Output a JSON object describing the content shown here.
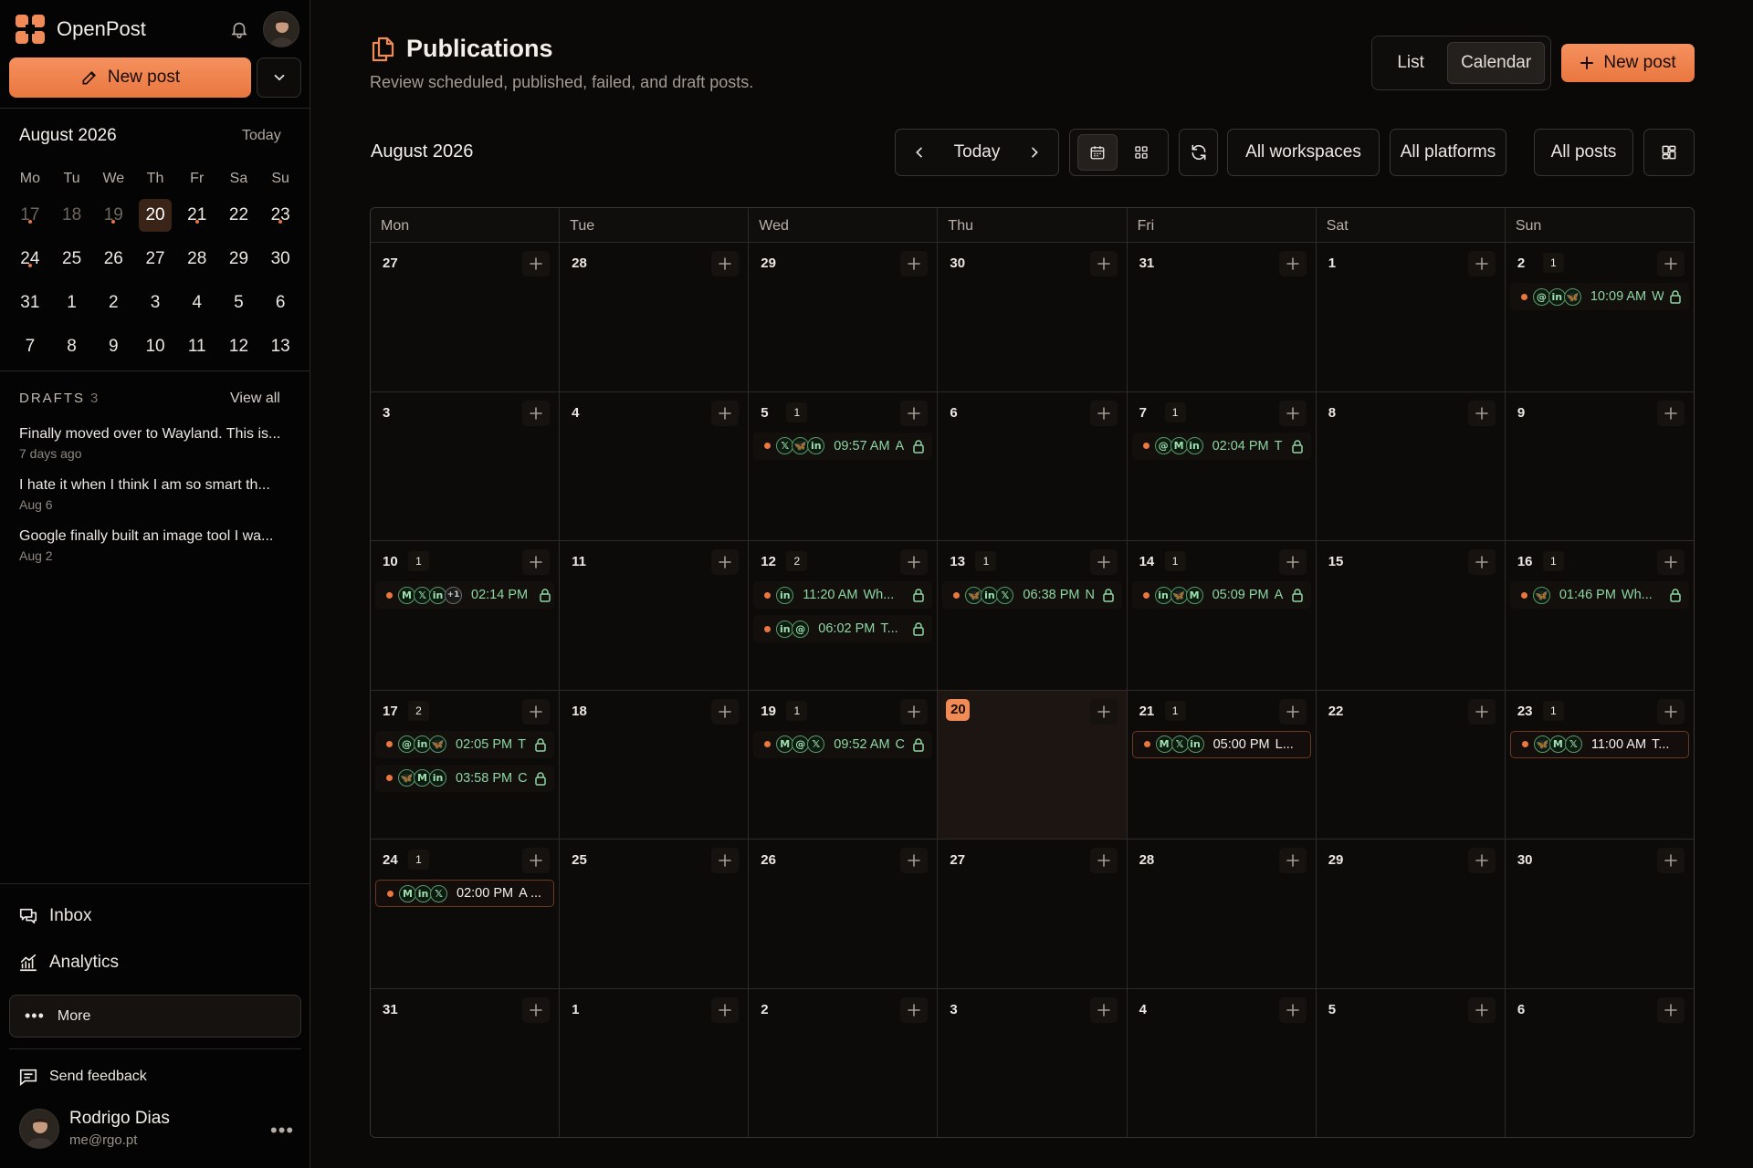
{
  "app": {
    "name": "OpenPost",
    "new_post_label": "New post"
  },
  "colors": {
    "accent": "#e9773f",
    "background": "#0a0908",
    "published": "#8fd6a3"
  },
  "mini_calendar": {
    "title": "August 2026",
    "today_label": "Today",
    "weekdays": [
      "Mo",
      "Tu",
      "We",
      "Th",
      "Fr",
      "Sa",
      "Su"
    ],
    "weeks": [
      [
        {
          "d": "17",
          "past": true,
          "dot": true
        },
        {
          "d": "18",
          "past": true
        },
        {
          "d": "19",
          "past": true,
          "dot": true
        },
        {
          "d": "20",
          "sel": true
        },
        {
          "d": "21",
          "dot": true
        },
        {
          "d": "22"
        },
        {
          "d": "23",
          "dot": true
        }
      ],
      [
        {
          "d": "24",
          "dot": true
        },
        {
          "d": "25"
        },
        {
          "d": "26"
        },
        {
          "d": "27"
        },
        {
          "d": "28"
        },
        {
          "d": "29"
        },
        {
          "d": "30"
        }
      ],
      [
        {
          "d": "31"
        },
        {
          "d": "1"
        },
        {
          "d": "2"
        },
        {
          "d": "3"
        },
        {
          "d": "4"
        },
        {
          "d": "5"
        },
        {
          "d": "6"
        }
      ],
      [
        {
          "d": "7"
        },
        {
          "d": "8"
        },
        {
          "d": "9"
        },
        {
          "d": "10"
        },
        {
          "d": "11"
        },
        {
          "d": "12"
        },
        {
          "d": "13"
        }
      ]
    ]
  },
  "drafts": {
    "heading": "DRAFTS",
    "count": "3",
    "view_all": "View all",
    "items": [
      {
        "text": "Finally moved over to Wayland. This is...",
        "date": "7 days ago"
      },
      {
        "text": "I hate it when I think I am so smart th...",
        "date": "Aug 6"
      },
      {
        "text": "Google finally built an image tool I wa...",
        "date": "Aug 2"
      }
    ]
  },
  "nav": {
    "inbox": "Inbox",
    "analytics": "Analytics",
    "more": "More",
    "feedback": "Send feedback"
  },
  "user": {
    "name": "Rodrigo Dias",
    "email": "me@rgo.pt"
  },
  "page": {
    "title": "Publications",
    "subtitle": "Review scheduled, published, failed, and draft posts."
  },
  "view_toggle": {
    "list": "List",
    "calendar": "Calendar",
    "active": "calendar"
  },
  "toolbar": {
    "month": "August 2026",
    "today": "Today",
    "workspaces": "All workspaces",
    "platforms": "All platforms",
    "posts": "All posts"
  },
  "calendar": {
    "weekdays": [
      "Mon",
      "Tue",
      "Wed",
      "Thu",
      "Fri",
      "Sat",
      "Sun"
    ],
    "weeks": [
      [
        {
          "d": "27"
        },
        {
          "d": "28"
        },
        {
          "d": "29"
        },
        {
          "d": "30"
        },
        {
          "d": "31"
        },
        {
          "d": "1"
        },
        {
          "d": "2",
          "count": "1",
          "posts": [
            {
              "plats": [
                "threads",
                "linkedin",
                "bluesky"
              ],
              "time": "10:09 AM",
              "title": "W"
            }
          ]
        }
      ],
      [
        {
          "d": "3"
        },
        {
          "d": "4"
        },
        {
          "d": "5",
          "count": "1",
          "posts": [
            {
              "plats": [
                "x",
                "bluesky",
                "linkedin"
              ],
              "time": "09:57 AM",
              "title": "A"
            }
          ]
        },
        {
          "d": "6"
        },
        {
          "d": "7",
          "count": "1",
          "posts": [
            {
              "plats": [
                "threads",
                "mastodon",
                "linkedin"
              ],
              "time": "02:04 PM",
              "title": "T"
            }
          ]
        },
        {
          "d": "8"
        },
        {
          "d": "9"
        }
      ],
      [
        {
          "d": "10",
          "count": "1",
          "posts": [
            {
              "plats": [
                "mastodon",
                "x",
                "linkedin"
              ],
              "extra": "+1",
              "time": "02:14 PM",
              "title": ""
            }
          ]
        },
        {
          "d": "11"
        },
        {
          "d": "12",
          "count": "2",
          "posts": [
            {
              "plats": [
                "linkedin"
              ],
              "time": "11:20 AM",
              "title": "Wh..."
            },
            {
              "plats": [
                "linkedin",
                "threads"
              ],
              "time": "06:02 PM",
              "title": "T..."
            }
          ]
        },
        {
          "d": "13",
          "count": "1",
          "posts": [
            {
              "plats": [
                "bluesky",
                "linkedin",
                "x"
              ],
              "time": "06:38 PM",
              "title": "N"
            }
          ]
        },
        {
          "d": "14",
          "count": "1",
          "posts": [
            {
              "plats": [
                "linkedin",
                "bluesky",
                "mastodon"
              ],
              "time": "05:09 PM",
              "title": "A"
            }
          ]
        },
        {
          "d": "15"
        },
        {
          "d": "16",
          "count": "1",
          "posts": [
            {
              "plats": [
                "bluesky"
              ],
              "time": "01:46 PM",
              "title": "Wh..."
            }
          ]
        }
      ],
      [
        {
          "d": "17",
          "count": "2",
          "posts": [
            {
              "plats": [
                "threads",
                "linkedin",
                "bluesky"
              ],
              "time": "02:05 PM",
              "title": "T"
            },
            {
              "plats": [
                "bluesky",
                "mastodon",
                "linkedin"
              ],
              "time": "03:58 PM",
              "title": "C"
            }
          ]
        },
        {
          "d": "18"
        },
        {
          "d": "19",
          "count": "1",
          "posts": [
            {
              "plats": [
                "mastodon",
                "threads",
                "x"
              ],
              "time": "09:52 AM",
              "title": "C"
            }
          ]
        },
        {
          "d": "20",
          "today": true
        },
        {
          "d": "21",
          "count": "1",
          "posts": [
            {
              "plats": [
                "mastodon",
                "x",
                "linkedin"
              ],
              "time": "05:00 PM",
              "title": "L...",
              "scheduled": true
            }
          ]
        },
        {
          "d": "22"
        },
        {
          "d": "23",
          "count": "1",
          "posts": [
            {
              "plats": [
                "bluesky",
                "mastodon",
                "x"
              ],
              "time": "11:00 AM",
              "title": "T...",
              "scheduled": true
            }
          ]
        }
      ],
      [
        {
          "d": "24",
          "count": "1",
          "posts": [
            {
              "plats": [
                "mastodon",
                "linkedin",
                "x"
              ],
              "time": "02:00 PM",
              "title": "A ...",
              "scheduled": true
            }
          ]
        },
        {
          "d": "25"
        },
        {
          "d": "26"
        },
        {
          "d": "27"
        },
        {
          "d": "28"
        },
        {
          "d": "29"
        },
        {
          "d": "30"
        }
      ],
      [
        {
          "d": "31"
        },
        {
          "d": "1"
        },
        {
          "d": "2"
        },
        {
          "d": "3"
        },
        {
          "d": "4"
        },
        {
          "d": "5"
        },
        {
          "d": "6"
        }
      ]
    ]
  }
}
